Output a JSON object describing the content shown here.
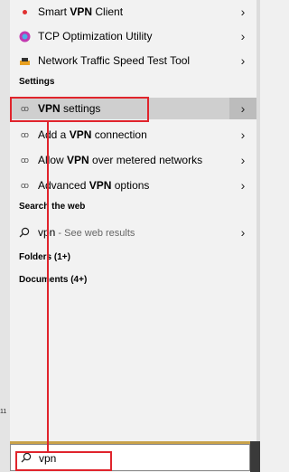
{
  "apps": [
    {
      "name": "Smart VPN Client",
      "pre": "Smart ",
      "bold": "VPN",
      "post": " Client",
      "icon": "smart-vpn-icon"
    },
    {
      "name": "TCP Optimization Utility",
      "pre": "TCP Optimization Utility",
      "bold": "",
      "post": "",
      "icon": "tcp-utility-icon"
    },
    {
      "name": "Network Traffic Speed Test Tool",
      "pre": "Network Traffic Speed Test Tool",
      "bold": "",
      "post": "",
      "icon": "speed-test-icon"
    }
  ],
  "settings_header": "Settings",
  "settings": [
    {
      "pre": "",
      "bold": "VPN",
      "post": " settings"
    },
    {
      "pre": "Add a ",
      "bold": "VPN",
      "post": " connection"
    },
    {
      "pre": "Allow ",
      "bold": "VPN",
      "post": " over metered networks"
    },
    {
      "pre": "Advanced ",
      "bold": "VPN",
      "post": " options"
    }
  ],
  "web_header": "Search the web",
  "web_result": {
    "query": "vpn",
    "suffix": " - See web results"
  },
  "folders": "Folders (1+)",
  "documents": "Documents (4+)",
  "taskbar_time": "11",
  "search": {
    "value": "vpn"
  },
  "colors": {
    "highlight": "#e0242c",
    "selected_row": "#cfcfcf"
  }
}
